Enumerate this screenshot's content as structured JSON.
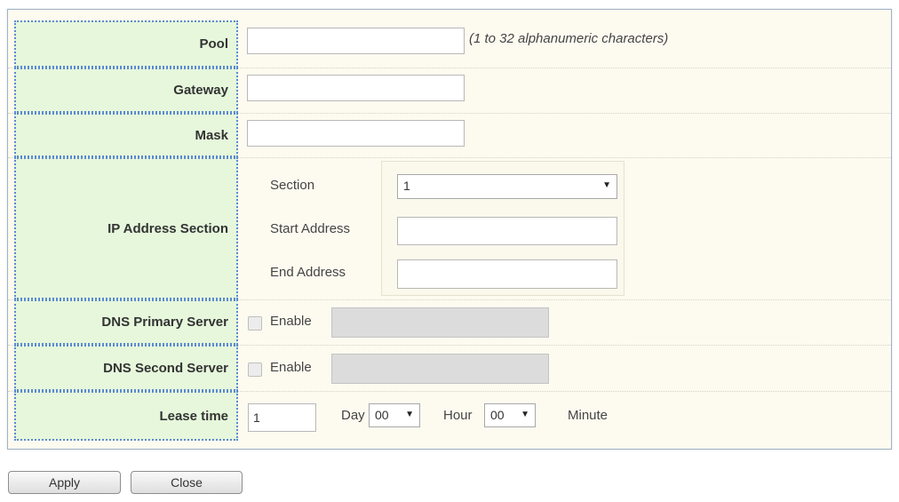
{
  "form": {
    "pool": {
      "label": "Pool",
      "value": "",
      "hint": "(1 to 32 alphanumeric characters)"
    },
    "gateway": {
      "label": "Gateway",
      "value": ""
    },
    "mask": {
      "label": "Mask",
      "value": ""
    },
    "ip_section": {
      "label": "IP Address Section",
      "section_label": "Section",
      "section_value": "1",
      "start_label": "Start Address",
      "start_value": "",
      "end_label": "End Address",
      "end_value": ""
    },
    "dns_primary": {
      "label": "DNS Primary Server",
      "enable_label": "Enable",
      "checked": false,
      "value": ""
    },
    "dns_second": {
      "label": "DNS Second Server",
      "enable_label": "Enable",
      "checked": false,
      "value": ""
    },
    "lease": {
      "label": "Lease time",
      "days_value": "1",
      "day_label": "Day",
      "hour_value": "00",
      "hour_label": "Hour",
      "minute_value": "00",
      "minute_label": "Minute"
    }
  },
  "buttons": {
    "apply": "Apply",
    "close": "Close"
  },
  "icons": {
    "dropdown": "caret-down-icon"
  },
  "colors": {
    "label_bg": "#e6f7dc",
    "label_border": "#5b8bd0",
    "panel_bg": "#fdfbf0",
    "disabled_bg": "#dcdcdc"
  }
}
